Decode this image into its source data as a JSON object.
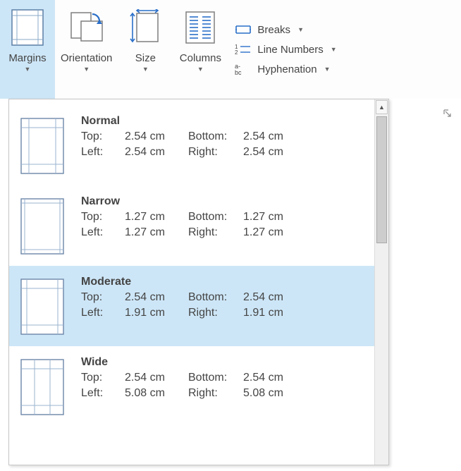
{
  "ribbon": {
    "margins": "Margins",
    "orientation": "Orientation",
    "size": "Size",
    "columns": "Columns",
    "breaks": "Breaks",
    "line_numbers": "Line Numbers",
    "hyphenation": "Hyphenation"
  },
  "labels": {
    "top": "Top:",
    "bottom": "Bottom:",
    "left": "Left:",
    "right": "Right:"
  },
  "margin_options": [
    {
      "name": "Normal",
      "top": "2.54 cm",
      "bottom": "2.54 cm",
      "left": "2.54 cm",
      "right": "2.54 cm",
      "hover": false,
      "thumb": "normal"
    },
    {
      "name": "Narrow",
      "top": "1.27 cm",
      "bottom": "1.27 cm",
      "left": "1.27 cm",
      "right": "1.27 cm",
      "hover": false,
      "thumb": "narrow"
    },
    {
      "name": "Moderate",
      "top": "2.54 cm",
      "bottom": "2.54 cm",
      "left": "1.91 cm",
      "right": "1.91 cm",
      "hover": true,
      "thumb": "moderate"
    },
    {
      "name": "Wide",
      "top": "2.54 cm",
      "bottom": "2.54 cm",
      "left": "5.08 cm",
      "right": "5.08 cm",
      "hover": false,
      "thumb": "wide"
    }
  ]
}
